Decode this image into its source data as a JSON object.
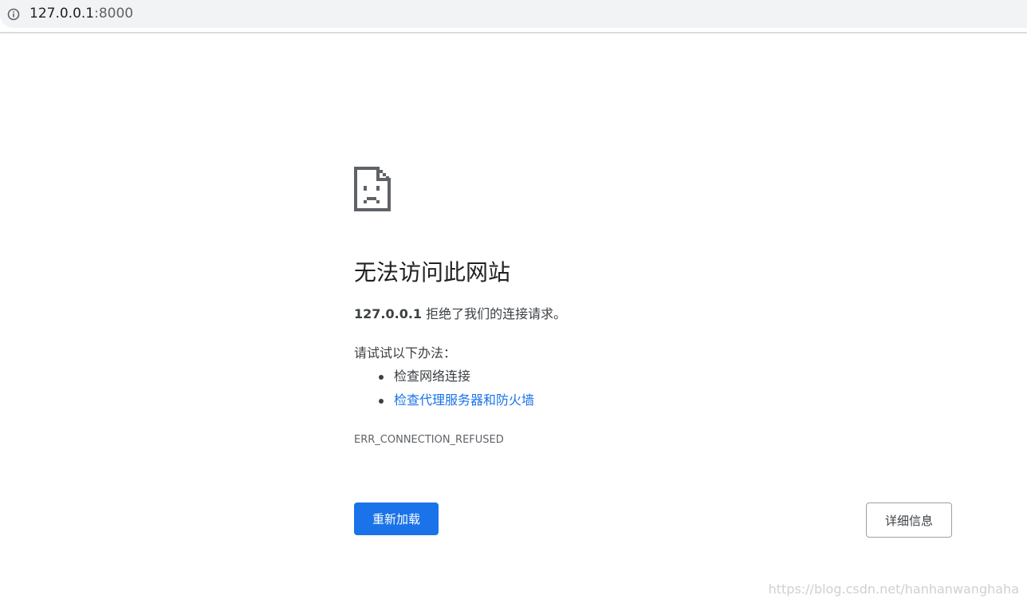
{
  "address_bar": {
    "host": "127.0.0.1",
    "port": ":8000",
    "info_icon": "info-icon"
  },
  "error": {
    "icon": "sad-page-icon",
    "title": "无法访问此网站",
    "description_host": "127.0.0.1",
    "description_text": " 拒绝了我们的连接请求。",
    "suggestions_heading": "请试试以下办法：",
    "suggestions": [
      {
        "label": "检查网络连接",
        "link": false
      },
      {
        "label": "检查代理服务器和防火墙",
        "link": true
      }
    ],
    "code": "ERR_CONNECTION_REFUSED"
  },
  "buttons": {
    "reload_label": "重新加载",
    "details_label": "详细信息"
  },
  "watermark": "https://blog.csdn.net/hanhanwanghaha",
  "colors": {
    "accent": "#1a73e8",
    "title": "#202124",
    "body_text": "#3c4043",
    "muted": "#5f6368"
  }
}
